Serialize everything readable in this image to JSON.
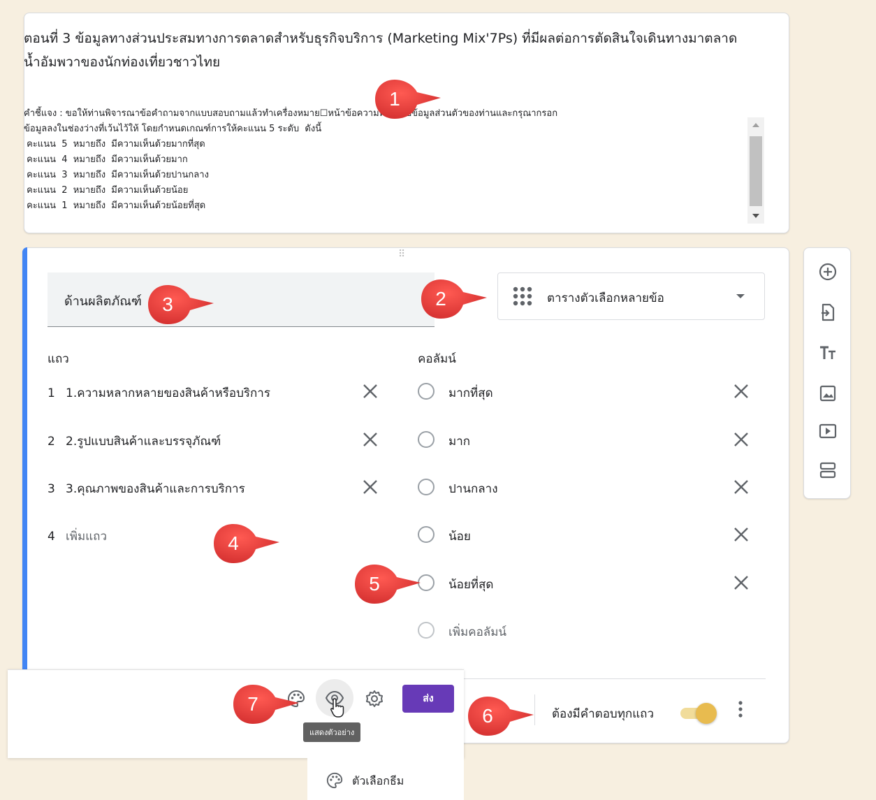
{
  "header": {
    "title": "ตอนที่ 3 ข้อมูลทางส่วนประสมทางการตลาดสำหรับธุรกิจบริการ (Marketing Mix'7Ps) ที่มีผลต่อการตัดสินใจเดินทางมาตลาดน้ำอัมพวาของนักท่องเที่ยวชาวไทย",
    "description_lines": [
      "คำชี้แจง : ขอให้ท่านพิจารณาข้อคำถามจากแบบสอบถามแล้วทำเครื่องหมาย☐หน้าข้อความที่ตรงกับข้อมูลส่วนตัวของท่านและกรุณากรอก",
      "ข้อมูลลงในช่องว่างที่เว้นไว้ให้ โดยกำหนดเกณฑ์การให้คะแนน 5 ระดับ  ดังนี้",
      " คะแนน  5  หมายถึง  มีความเห็นด้วยมากที่สุด",
      " คะแนน  4  หมายถึง  มีความเห็นด้วยมาก",
      " คะแนน  3  หมายถึง  มีความเห็นด้วยปานกลาง",
      " คะแนน  2  หมายถึง  มีความเห็นด้วยน้อย",
      " คะแนน  1  หมายถึง  มีความเห็นด้วยน้อยที่สุด"
    ]
  },
  "question": {
    "title": "ด้านผลิตภัณฑ์",
    "type_label": "ตารางตัวเลือกหลายข้อ",
    "rows_heading": "แถว",
    "columns_heading": "คอลัมน์",
    "rows": [
      {
        "num": "1",
        "label": "1.ความหลากหลายของสินค้าหรือบริการ"
      },
      {
        "num": "2",
        "label": "2.รูปแบบสินค้าและบรรจุภัณฑ์"
      },
      {
        "num": "3",
        "label": "3.คุณภาพของสินค้าและการบริการ"
      }
    ],
    "add_row": {
      "num": "4",
      "label": "เพิ่มแถว"
    },
    "columns": [
      "มากที่สุด",
      "มาก",
      "ปานกลาง",
      "น้อย",
      "น้อยที่สุด"
    ],
    "add_column": "เพิ่มคอลัมน์",
    "required_label": "ต้องมีคำตอบทุกแถว",
    "required_on": true
  },
  "toolbar": {
    "send_label": "ส่ง",
    "preview_tooltip": "แสดงตัวอย่าง",
    "theme_menu_label": "ตัวเลือกธีม"
  },
  "side_tools": [
    "add-question-icon",
    "import-questions-icon",
    "add-title-icon",
    "add-image-icon",
    "add-video-icon",
    "add-section-icon"
  ],
  "callouts": [
    "1",
    "2",
    "3",
    "4",
    "5",
    "6",
    "7"
  ],
  "colors": {
    "accent": "#4285f4",
    "send": "#673ab7",
    "callout": "#e53935",
    "toggle": "#e8bb4f"
  }
}
